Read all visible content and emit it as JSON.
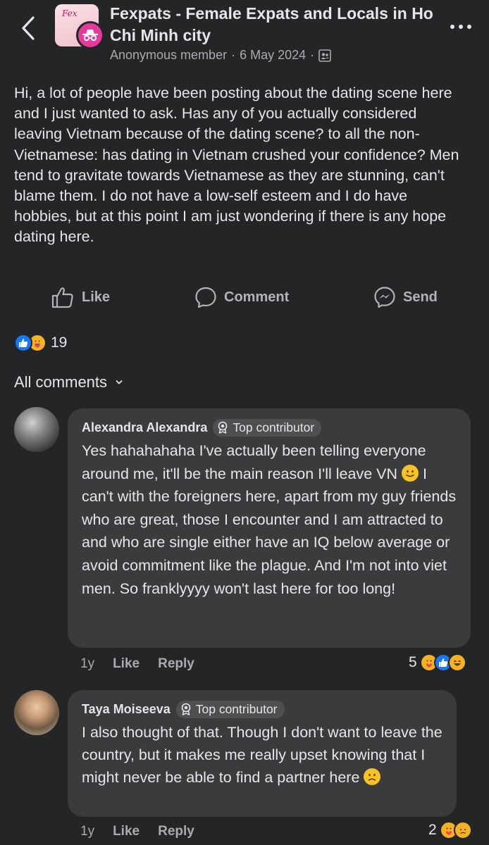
{
  "header": {
    "group_name": "Fexpats - Female Expats and Locals in Ho Chi Minh city",
    "author": "Anonymous member",
    "date": "6 May 2024",
    "separator": "·",
    "avatar_text": "Fex",
    "privacy_icon": "members-icon"
  },
  "post": {
    "text": "Hi, a lot of people have been posting about the dating scene here and I just wanted to ask. Has any of you actually considered leaving Vietnam because of the dating scene? to all the non-Vietnamese: has dating in Vietnam crushed your confidence? Men tend to gravitate towards Vietnamese as they are stunning, can't blame them. I do not have a low-self esteem and I do have hobbies, but at this point I am just wondering if there is any hope dating here."
  },
  "actions": {
    "like": "Like",
    "comment": "Comment",
    "send": "Send"
  },
  "reactions": {
    "count": "19",
    "types": [
      "like",
      "care"
    ]
  },
  "comments_header": {
    "label": "All comments"
  },
  "comments": [
    {
      "name": "Alexandra Alexandra",
      "badge": "Top contributor",
      "text_before_emoji": "Yes hahahahaha I've actually been telling everyone around me, it'll be the main reason I'll leave VN ",
      "emoji": "slightly-smiling-face",
      "text_after_emoji": " I can't with the foreigners here, apart from my guy friends who are great, those I encounter and I am attracted to and who are single either have an IQ below average or avoid commitment like the plague. And I'm not into viet men. So franklyyyy won't last here for too long!",
      "time": "1y",
      "like": "Like",
      "reply": "Reply",
      "reaction_count": "5",
      "reaction_types": [
        "care",
        "like",
        "haha"
      ]
    },
    {
      "name": "Taya Moiseeva",
      "badge": "Top contributor",
      "text_before_emoji": "I also thought of that. Though I don't want to leave the country, but it makes me really upset knowing that I might never be able to find a partner here ",
      "emoji": "slightly-frowning-face",
      "text_after_emoji": "",
      "time": "1y",
      "like": "Like",
      "reply": "Reply",
      "reaction_count": "2",
      "reaction_types": [
        "care",
        "sad"
      ]
    }
  ],
  "colors": {
    "background": "#242526",
    "bubble": "#3a3b3c",
    "text": "#e4e6eb",
    "secondary_text": "#a8abaf",
    "like_blue": "#1877f2",
    "reaction_yellow": "#f7b125",
    "anon_pink": "#e7389c"
  }
}
